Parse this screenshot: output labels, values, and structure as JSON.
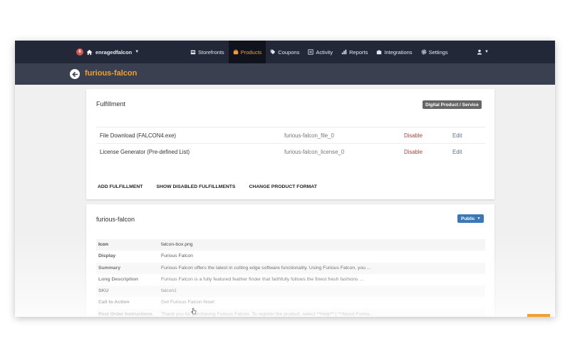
{
  "topbar": {
    "notification_count": "6",
    "account": "enragedfalcon",
    "nav": [
      "Storefronts",
      "Products",
      "Coupons",
      "Activity",
      "Reports",
      "Integrations",
      "Settings"
    ],
    "active_nav": "Products"
  },
  "page": {
    "title": "furious-falcon"
  },
  "fulfillment": {
    "title": "Fulfillment",
    "type_badge": "Digital Product / Service",
    "rows": [
      {
        "name": "File Download (FALCON4.exe)",
        "id": "furious-falcon_file_0",
        "action": "Disable",
        "edit": "Edit"
      },
      {
        "name": "License Generator (Pre-defined List)",
        "id": "furious-falcon_license_0",
        "action": "Disable",
        "edit": "Edit"
      }
    ],
    "actions": [
      "ADD FULFILLMENT",
      "SHOW DISABLED FULFILLMENTS",
      "CHANGE PRODUCT FORMAT"
    ]
  },
  "product": {
    "title": "furious-falcon",
    "visibility": "Public",
    "props": [
      {
        "key": "Icon",
        "value": "falcon-box.png"
      },
      {
        "key": "Display",
        "value": "Furious Falcon"
      },
      {
        "key": "Summary",
        "value": "Furious Falcon offers the latest in cutting edge software functionality. Using Furious Falcon, you ..."
      },
      {
        "key": "Long Description",
        "value": "Furious Falcon is a fully featured feather finder that faithfully follows the finest fresh fashions ..."
      },
      {
        "key": "SKU",
        "value": "falcon1"
      },
      {
        "key": "Call to Action",
        "value": "Get Furious Falcon Now!"
      },
      {
        "key": "Post Order Instructions",
        "value": "Thank you for purchasing Furious Falcon. To register the product, select **Help** | **About Furiou..."
      }
    ]
  },
  "colors": {
    "topbar": "#232838",
    "subbar": "#3b4050",
    "accent": "#f0a030",
    "disable": "#a94442",
    "public": "#3a78b8"
  }
}
